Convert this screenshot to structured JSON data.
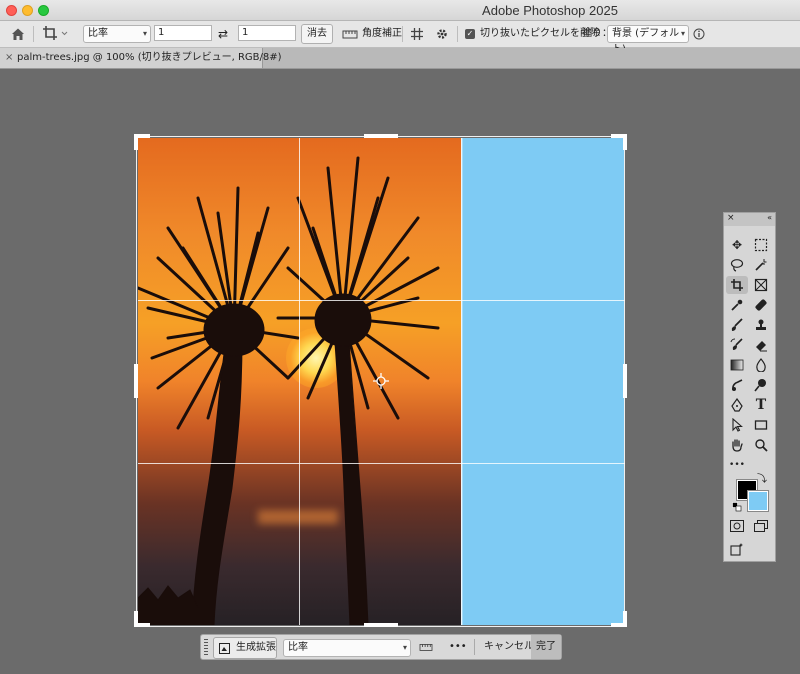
{
  "window": {
    "app_title": "Adobe Photoshop 2025"
  },
  "options_bar": {
    "ratio_select": "比率",
    "width_value": "1",
    "height_value": "1",
    "clear_button": "消去",
    "straighten_label": "角度補正",
    "delete_cropped_label": "切り抜いたピクセルを削除",
    "delete_cropped_checked": true,
    "fill_label": "塗り：",
    "fill_select": "背景 (デフォルト)"
  },
  "document": {
    "tab_title": "palm-trees.jpg @ 100% (切り抜きプレビュー, RGB/8#)",
    "close_glyph": "×"
  },
  "taskbar": {
    "generative_expand": "生成拡張",
    "ratio_select": "比率",
    "more": "•••",
    "cancel": "キャンセル",
    "done": "完了"
  },
  "colors": {
    "foreground": "#000000",
    "background": "#7ecbf4",
    "canvas_extension": "#7ecbf4"
  },
  "tools": [
    "move-tool",
    "marquee-tool",
    "lasso-tool",
    "magic-wand-tool",
    "crop-tool",
    "frame-tool",
    "eyedropper-tool",
    "healing-brush-tool",
    "brush-tool",
    "stamp-tool",
    "history-brush-tool",
    "eraser-tool",
    "gradient-tool",
    "blur-tool",
    "dodge-tool",
    "smudge-tool",
    "pen-tool",
    "type-tool",
    "path-selection-tool",
    "rectangle-tool",
    "hand-tool",
    "zoom-tool",
    "more-tools"
  ],
  "tool_labels": {
    "type_tool": "T",
    "more_tools": "•••"
  },
  "active_tool": "crop-tool"
}
